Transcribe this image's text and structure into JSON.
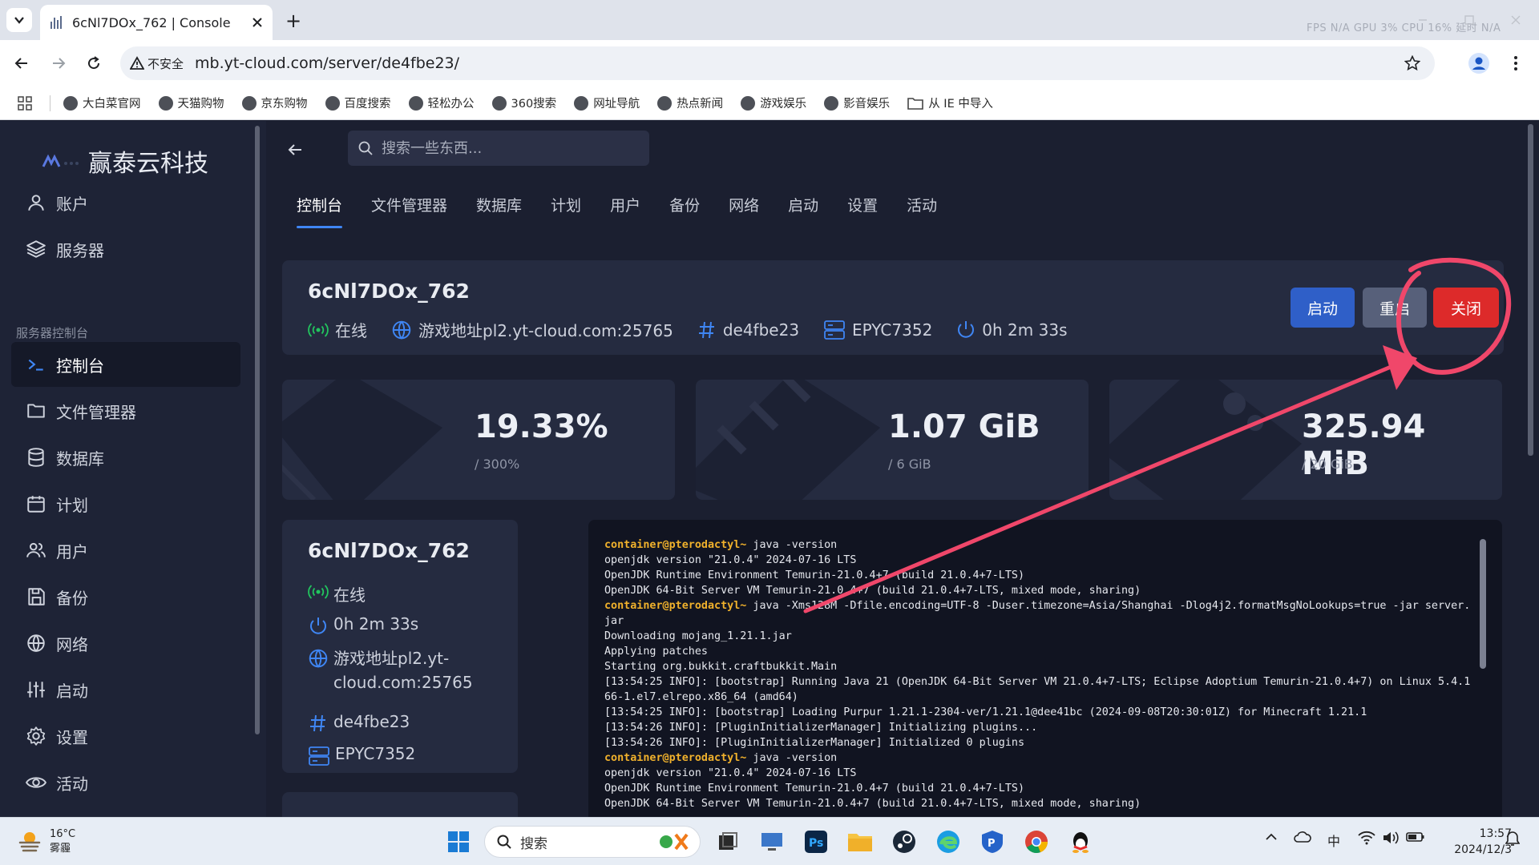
{
  "browser": {
    "tab_title": "6cNl7DOx_762 | Console",
    "new_tab": "+",
    "security_label": "不安全",
    "url": "mb.yt-cloud.com/server/de4fbe23/",
    "overlay_stats": "FPS N/A GPU 3% CPU 16% 延时 N/A",
    "bookmarks": [
      {
        "label": "大白菜官网"
      },
      {
        "label": "天猫购物"
      },
      {
        "label": "京东购物"
      },
      {
        "label": "百度搜索"
      },
      {
        "label": "轻松办公"
      },
      {
        "label": "360搜索"
      },
      {
        "label": "网址导航"
      },
      {
        "label": "热点新闻"
      },
      {
        "label": "游戏娱乐"
      },
      {
        "label": "影音娱乐"
      },
      {
        "label": "从 IE 中导入"
      }
    ]
  },
  "sidebar": {
    "brand_title": "赢泰云科技",
    "items_top": [
      {
        "label": "账户",
        "icon": "user-icon"
      },
      {
        "label": "服务器",
        "icon": "layers-icon"
      }
    ],
    "section_label": "服务器控制台",
    "items": [
      {
        "label": "控制台",
        "icon": "terminal-icon",
        "active": true
      },
      {
        "label": "文件管理器",
        "icon": "folder-icon"
      },
      {
        "label": "数据库",
        "icon": "database-icon"
      },
      {
        "label": "计划",
        "icon": "calendar-icon"
      },
      {
        "label": "用户",
        "icon": "users-icon"
      },
      {
        "label": "备份",
        "icon": "save-icon"
      },
      {
        "label": "网络",
        "icon": "globe-icon"
      },
      {
        "label": "启动",
        "icon": "sliders-icon"
      },
      {
        "label": "设置",
        "icon": "gear-icon"
      },
      {
        "label": "活动",
        "icon": "eye-icon"
      }
    ]
  },
  "main": {
    "search_placeholder": "搜索一些东西...",
    "tabs": [
      "控制台",
      "文件管理器",
      "数据库",
      "计划",
      "用户",
      "备份",
      "网络",
      "启动",
      "设置",
      "活动"
    ],
    "server": {
      "name": "6cNl7DOx_762",
      "status": "在线",
      "address": "游戏地址pl2.yt-cloud.com:25765",
      "address_line1": "游戏地址pl2.yt-",
      "address_line2": "cloud.com:25765",
      "id": "de4fbe23",
      "node": "EPYC7352",
      "uptime": "0h 2m 33s"
    },
    "buttons": {
      "start": "启动",
      "restart": "重启",
      "stop": "关闭"
    },
    "stats": [
      {
        "value": "19.33%",
        "limit": "/ 300%"
      },
      {
        "value": "1.07 GiB",
        "limit": "/ 6 GiB"
      },
      {
        "value": "325.94 MiB",
        "limit": "/ 20 GiB"
      }
    ],
    "console_lines": [
      {
        "prompt": "container@pterodactyl~",
        "text": " java -version"
      },
      {
        "prompt": "",
        "text": "openjdk version \"21.0.4\" 2024-07-16 LTS"
      },
      {
        "prompt": "",
        "text": "OpenJDK Runtime Environment Temurin-21.0.4+7 (build 21.0.4+7-LTS)"
      },
      {
        "prompt": "",
        "text": "OpenJDK 64-Bit Server VM Temurin-21.0.4+7 (build 21.0.4+7-LTS, mixed mode, sharing)"
      },
      {
        "prompt": "container@pterodactyl~",
        "text": " java -Xms128M -Dfile.encoding=UTF-8 -Duser.timezone=Asia/Shanghai -Dlog4j2.formatMsgNoLookups=true -jar server.jar"
      },
      {
        "prompt": "",
        "text": "Downloading mojang_1.21.1.jar"
      },
      {
        "prompt": "",
        "text": "Applying patches"
      },
      {
        "prompt": "",
        "text": "Starting org.bukkit.craftbukkit.Main"
      },
      {
        "prompt": "",
        "text": "[13:54:25 INFO]: [bootstrap] Running Java 21 (OpenJDK 64-Bit Server VM 21.0.4+7-LTS; Eclipse Adoptium Temurin-21.0.4+7) on Linux 5.4.166-1.el7.elrepo.x86_64 (amd64)"
      },
      {
        "prompt": "",
        "text": "[13:54:25 INFO]: [bootstrap] Loading Purpur 1.21.1-2304-ver/1.21.1@dee41bc (2024-09-08T20:30:01Z) for Minecraft 1.21.1"
      },
      {
        "prompt": "",
        "text": "[13:54:26 INFO]: [PluginInitializerManager] Initializing plugins..."
      },
      {
        "prompt": "",
        "text": "[13:54:26 INFO]: [PluginInitializerManager] Initialized 0 plugins"
      },
      {
        "prompt": "container@pterodactyl~",
        "text": " java -version"
      },
      {
        "prompt": "",
        "text": "openjdk version \"21.0.4\" 2024-07-16 LTS"
      },
      {
        "prompt": "",
        "text": "OpenJDK Runtime Environment Temurin-21.0.4+7 (build 21.0.4+7-LTS)"
      },
      {
        "prompt": "",
        "text": "OpenJDK 64-Bit Server VM Temurin-21.0.4+7 (build 21.0.4+7-LTS, mixed mode, sharing)"
      }
    ]
  },
  "taskbar": {
    "weather_temp": "16°C",
    "weather_desc": "雾霾",
    "search_label": "搜索",
    "ime": "中",
    "time": "13:57",
    "date": "2024/12/3"
  },
  "colors": {
    "accent": "#3f86f4",
    "online": "#22c55e",
    "stop": "#dd2a2a",
    "annotation": "#f0476a",
    "console_prompt": "#f0b12c"
  }
}
